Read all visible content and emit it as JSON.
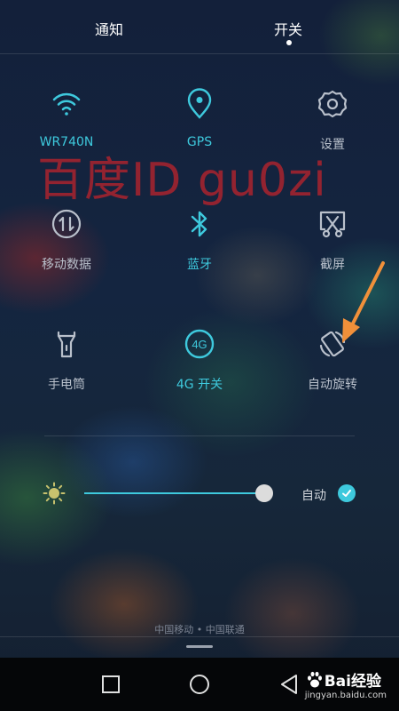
{
  "tabs": [
    {
      "label": "通知",
      "active": false
    },
    {
      "label": "开关",
      "active": true
    }
  ],
  "toggles": [
    {
      "label": "WR740N",
      "icon": "wifi-icon",
      "on": true
    },
    {
      "label": "GPS",
      "icon": "location-icon",
      "on": true
    },
    {
      "label": "设置",
      "icon": "gear-icon",
      "on": false
    },
    {
      "label": "移动数据",
      "icon": "mobile-data-icon",
      "on": false
    },
    {
      "label": "蓝牙",
      "icon": "bluetooth-icon",
      "on": true
    },
    {
      "label": "截屏",
      "icon": "screenshot-icon",
      "on": false
    },
    {
      "label": "手电筒",
      "icon": "flashlight-icon",
      "on": false
    },
    {
      "label": "4G 开关",
      "icon": "4g-icon",
      "on": true
    },
    {
      "label": "自动旋转",
      "icon": "auto-rotate-icon",
      "on": false
    }
  ],
  "icon_text": {
    "lte": "4G"
  },
  "watermark": "百度ID gu0zi",
  "brightness": {
    "level": 0.9,
    "auto_label": "自动",
    "auto_checked": true
  },
  "carrier": "中国移动 • 中国联通",
  "baidu_logo": {
    "brand": "Bai经验",
    "url": "jingyan.baidu.com"
  },
  "colors": {
    "accent": "#3ec9dd",
    "inactive": "#b9c0cb",
    "watermark": "#b0232e",
    "arrow": "#f0903a"
  }
}
